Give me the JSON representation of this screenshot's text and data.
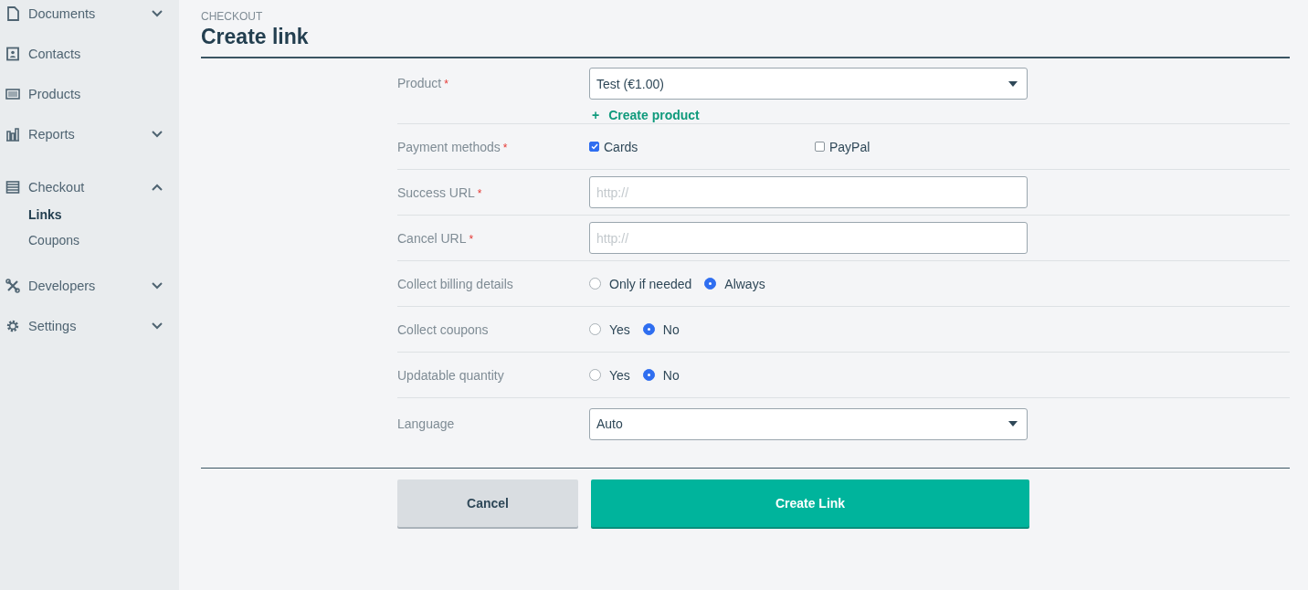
{
  "sidebar": {
    "items": [
      {
        "label": "Documents",
        "expanded": false
      },
      {
        "label": "Contacts"
      },
      {
        "label": "Products"
      },
      {
        "label": "Reports",
        "expanded": false
      },
      {
        "label": "Checkout",
        "expanded": true,
        "children": [
          {
            "label": "Links",
            "selected": true
          },
          {
            "label": "Coupons",
            "selected": false
          }
        ]
      },
      {
        "label": "Developers",
        "expanded": false
      },
      {
        "label": "Settings",
        "expanded": false
      }
    ]
  },
  "header": {
    "section": "CHECKOUT",
    "title": "Create link"
  },
  "form": {
    "fields": [
      {
        "kind": "select",
        "label": "Product",
        "required_mark": "*",
        "value": "Test (€1.00)",
        "link": {
          "icon": "+",
          "label": "Create product"
        }
      },
      {
        "kind": "checkboxes",
        "label": "Payment methods",
        "required_mark": "*",
        "options": [
          {
            "label": "Cards",
            "checked": true
          },
          {
            "label": "PayPal",
            "checked": false
          }
        ]
      },
      {
        "kind": "text",
        "label": "Success URL",
        "required_mark": "*",
        "placeholder": "http://"
      },
      {
        "kind": "text",
        "label": "Cancel URL",
        "required_mark": "*",
        "placeholder": "http://"
      },
      {
        "kind": "radios",
        "label": "Collect billing details",
        "options": [
          {
            "label": "Only if needed",
            "selected": false
          },
          {
            "label": "Always",
            "selected": true
          }
        ]
      },
      {
        "kind": "radios",
        "label": "Collect coupons",
        "options": [
          {
            "label": "Yes",
            "selected": false
          },
          {
            "label": "No",
            "selected": true
          }
        ]
      },
      {
        "kind": "radios",
        "label": "Updatable quantity",
        "options": [
          {
            "label": "Yes",
            "selected": false
          },
          {
            "label": "No",
            "selected": true
          }
        ]
      },
      {
        "kind": "select",
        "label": "Language",
        "value": "Auto"
      }
    ]
  },
  "buttons": [
    {
      "kind": "secondary",
      "label": "Cancel"
    },
    {
      "kind": "primary",
      "label": "Create Link"
    }
  ]
}
